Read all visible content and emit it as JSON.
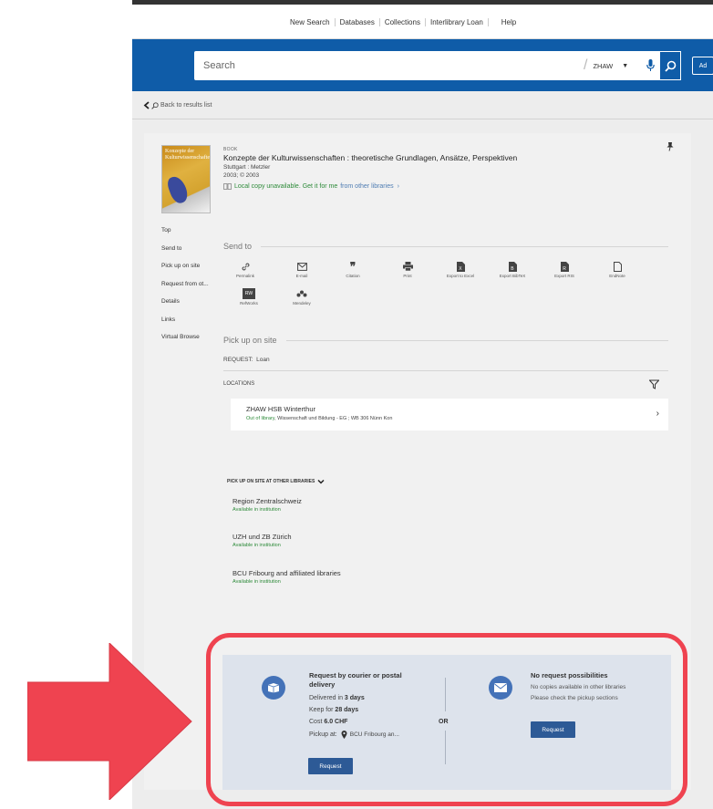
{
  "top_nav": {
    "links": [
      "New Search",
      "Databases",
      "Collections",
      "Interlibrary Loan",
      "Help"
    ]
  },
  "search": {
    "placeholder": "Search",
    "scope": "ZHAW",
    "advanced_label": "Ad"
  },
  "back_label": "Back to results list",
  "record": {
    "type": "BOOK",
    "title": "Konzepte der Kulturwissenschaften : theoretische Grundlagen, Ansätze, Perspektiven",
    "publisher": "Stuttgart : Metzler",
    "date": "2003; © 2003",
    "availability": "Local copy unavailable. Get it for me",
    "availability_link": "from other libraries",
    "cover_text": "Konzepte der Kulturwissenschaften"
  },
  "left_nav": [
    "Top",
    "Send to",
    "Pick up on site",
    "Request from ot...",
    "Details",
    "Links",
    "Virtual Browse"
  ],
  "send_to": {
    "heading": "Send to",
    "items": [
      {
        "label": "Permalink",
        "icon": "link-icon"
      },
      {
        "label": "E-mail",
        "icon": "email-icon"
      },
      {
        "label": "Citation",
        "icon": "quote-icon"
      },
      {
        "label": "Print",
        "icon": "print-icon"
      },
      {
        "label": "Export to Excel",
        "icon": "excel-icon"
      },
      {
        "label": "Export BibTeX",
        "icon": "bibtex-icon"
      },
      {
        "label": "Export RIS",
        "icon": "ris-icon"
      },
      {
        "label": "EndNote",
        "icon": "endnote-icon"
      },
      {
        "label": "RefWorks",
        "icon": "refworks-icon",
        "badge": "RW"
      },
      {
        "label": "Mendeley",
        "icon": "mendeley-icon"
      }
    ]
  },
  "pickup": {
    "heading": "Pick up on site",
    "request_label": "REQUEST:",
    "request_value": "Loan",
    "locations_label": "LOCATIONS",
    "location": {
      "name": "ZHAW HSB Winterthur",
      "status": "Out of library",
      "detail": ", Wissenschaft und Bildung - EG ; WB 306 Nünn Kon"
    }
  },
  "other_libraries": {
    "heading": "PICK UP ON SITE AT OTHER LIBRARIES",
    "items": [
      {
        "name": "Region Zentralschweiz",
        "status": "Available in institution"
      },
      {
        "name": "UZH und ZB Zürich",
        "status": "Available in institution"
      },
      {
        "name": "BCU Fribourg and affiliated libraries",
        "status": "Available in institution"
      }
    ]
  },
  "courier": {
    "heading": "Request by courier or postal delivery",
    "delivered_prefix": "Delivered in",
    "delivered_value": "3 days",
    "keep_prefix": "Keep for",
    "keep_value": "28 days",
    "cost_prefix": "Cost",
    "cost_value": "6.0 CHF",
    "pickup_prefix": "Pickup at:",
    "pickup_value": "BCU Fribourg an...",
    "button": "Request"
  },
  "or_label": "OR",
  "no_request": {
    "heading": "No request possibilities",
    "line1": "No copies available in other libraries",
    "line2": "Please check the pickup sections",
    "button": "Request"
  },
  "colors": {
    "brand_blue": "#0f5ca8",
    "green": "#2e8b3a",
    "highlight_red": "#ef4350",
    "button_blue": "#2d5a96"
  }
}
